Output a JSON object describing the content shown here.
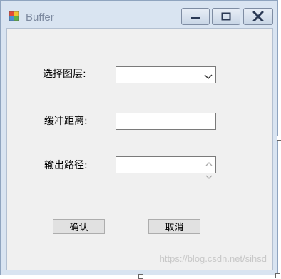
{
  "window": {
    "title": "Buffer"
  },
  "form": {
    "layer_label": "选择图层:",
    "distance_label": "缓冲距离:",
    "output_label": "输出路径:",
    "layer_value": "",
    "distance_value": "",
    "output_value": ""
  },
  "buttons": {
    "confirm": "确认",
    "cancel": "取消"
  },
  "watermark": "https://blog.csdn.net/sihsd",
  "icons": {
    "app": "app-icon",
    "minimize": "minimize-icon",
    "maximize": "maximize-icon",
    "close": "close-icon",
    "dropdown": "chevron-down-icon",
    "spinner_up": "chevron-up-icon",
    "spinner_down": "chevron-down-icon"
  }
}
